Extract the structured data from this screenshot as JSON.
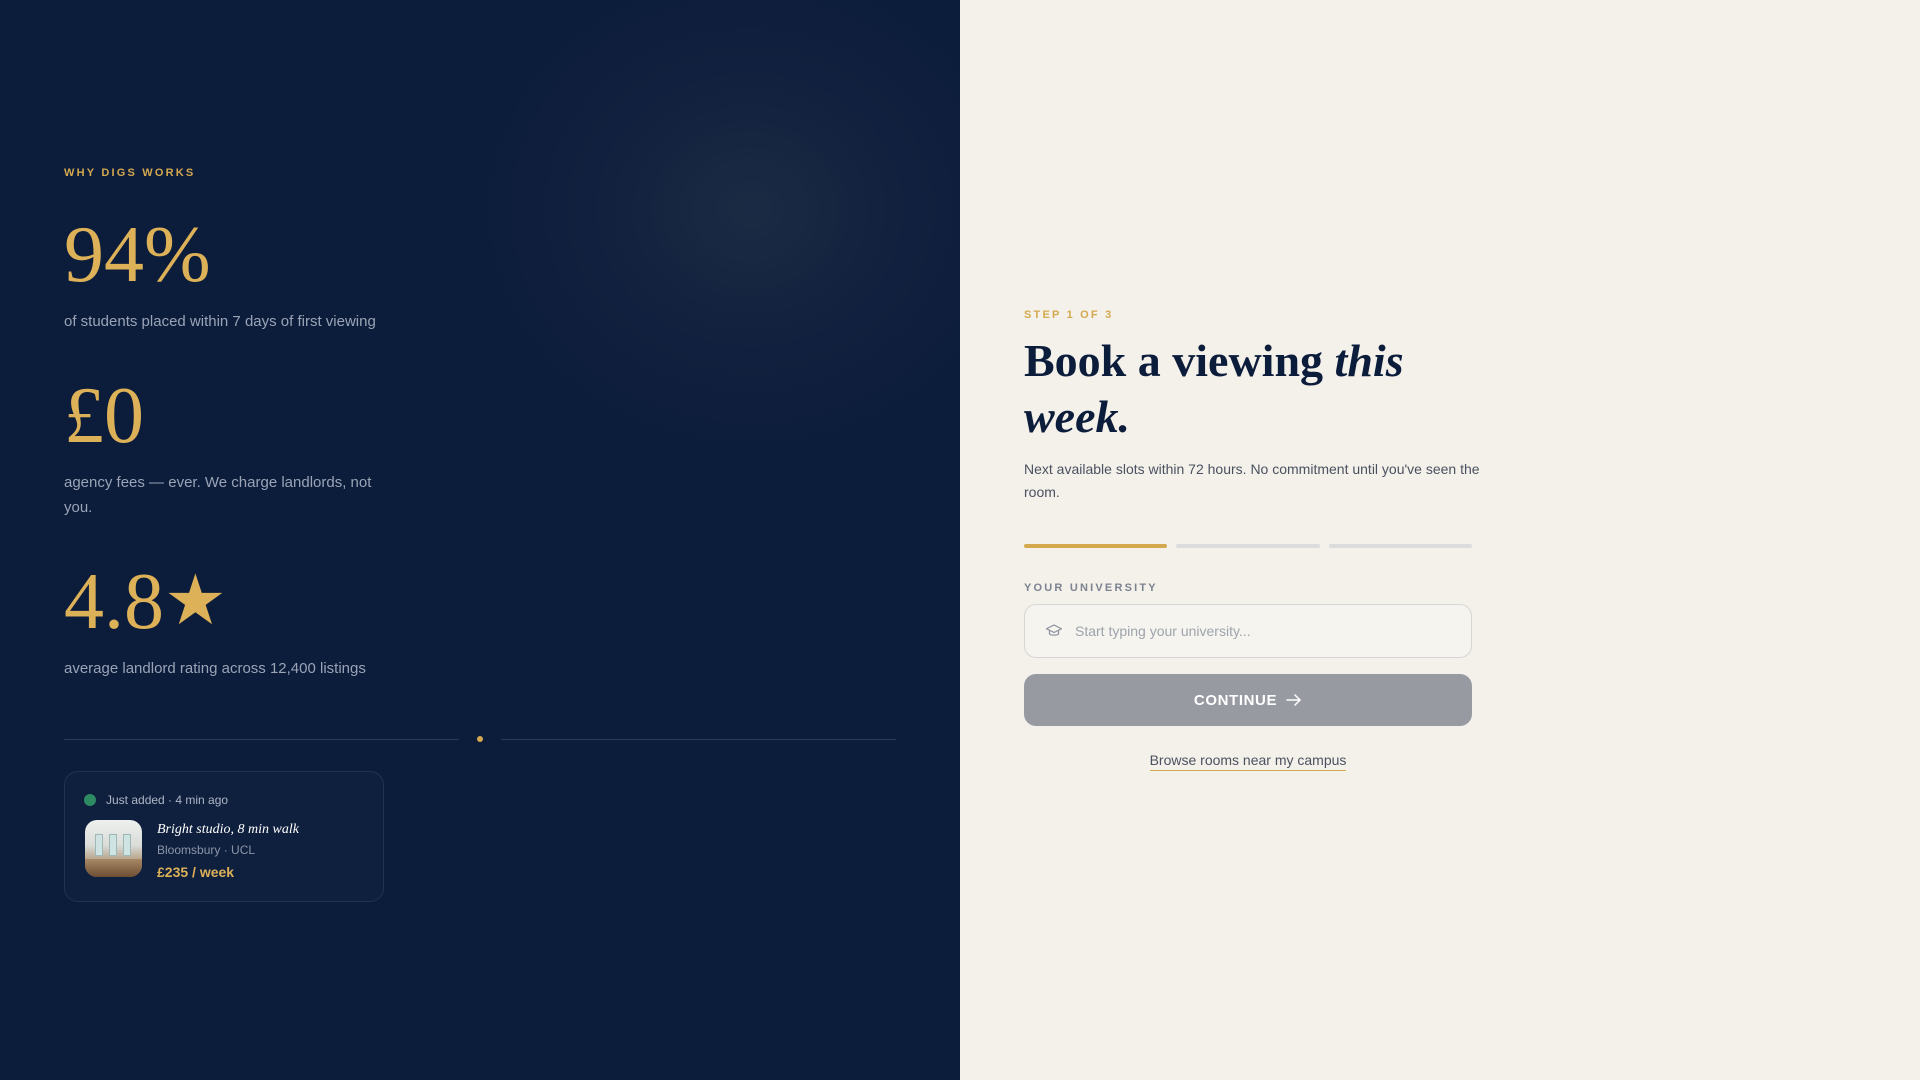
{
  "left": {
    "eyebrow": "WHY DIGS WORKS",
    "stats": [
      {
        "value": "94%",
        "caption": "of students placed within 7 days of first viewing"
      },
      {
        "value": "£0",
        "caption": "agency fees — ever. We charge landlords, not you."
      },
      {
        "value": "4.8",
        "star": "★",
        "caption": "average landlord rating across 12,400 listings"
      }
    ],
    "listing": {
      "status": "Just added · 4 min ago",
      "title": "Bright studio, 8 min walk",
      "location": "Bloomsbury · UCL",
      "price": "£235 / week",
      "image_icon": "room-photo"
    }
  },
  "right": {
    "step": "STEP 1 OF 3",
    "headline_plain": "Book a viewing ",
    "headline_italic": "this week.",
    "subtext": "Next available slots within 72 hours. No commitment until you've seen the room.",
    "progress": {
      "current_step": 1,
      "total_steps": 3
    },
    "university_label": "YOUR UNIVERSITY",
    "university_placeholder": "Start typing your university...",
    "university_value": "",
    "input_icon": "graduation-cap-icon",
    "continue_label": "CONTINUE",
    "continue_icon": "arrow-right-icon",
    "browse_link": "Browse rooms near my campus"
  },
  "colors": {
    "navy": "#0c1c3b",
    "gold": "#ddb158",
    "cream": "#f4f1ea",
    "button_disabled": "#979aa1",
    "status_green": "#2e8a63"
  }
}
